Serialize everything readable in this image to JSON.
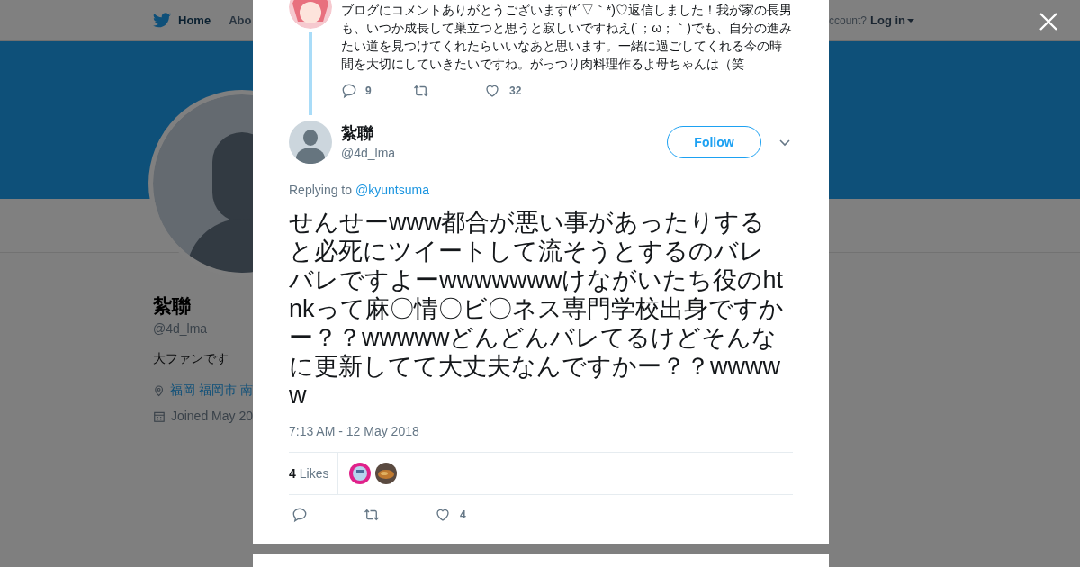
{
  "nav": {
    "items": [
      {
        "label": "Home",
        "selected": true
      },
      {
        "label": "Abo",
        "selected": false
      }
    ],
    "account_prompt": "ccount?",
    "login": "Log in"
  },
  "profile": {
    "name": "紮聯",
    "handle": "@4d_lma",
    "bio": "大ファンです",
    "location": "福岡 福岡市 南",
    "joined": "Joined May 20"
  },
  "parent_tweet": {
    "text": "ブログにコメントありがとうございます(*´▽｀*)♡返信しました！我が家の長男も、いつか成長して巣立つと思うと寂しいですねえ(´；ω；｀)でも、自分の進みたい道を見つけてくれたらいいなあと思います。一緒に過ごしてくれる今の時間を大切にしていきたいですね。がっつり肉料理作るよ母ちゃんは（笑",
    "replies": "9",
    "likes": "32"
  },
  "tweet": {
    "name": "紮聯",
    "handle": "@4d_lma",
    "follow": "Follow",
    "replying_prefix": "Replying to",
    "replying_to": "@kyuntsuma",
    "text": "せんせーwww都合が悪い事があったりすると必死にツイートして流そうとするのバレバレですよーwwwwwwwけながいたち役のhtnkって麻〇情〇ビ〇ネス専門学校出身ですかー？？wwwwwどんどんバレてるけどそんなに更新してて大丈夫なんですかー？？wwwww",
    "timestamp": "7:13 AM - 12 May 2018",
    "likes_count": "4",
    "likes_label": "Likes",
    "like_count": "4"
  }
}
